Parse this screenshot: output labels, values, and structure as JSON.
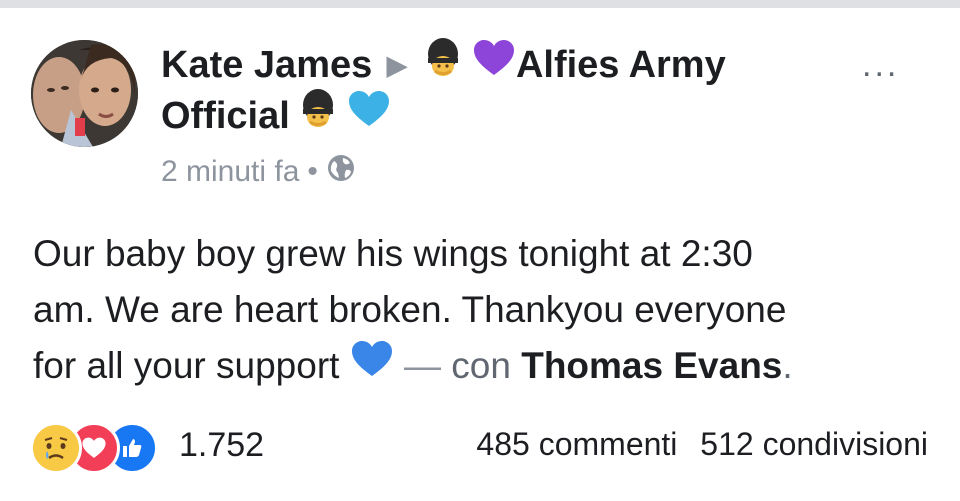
{
  "post": {
    "author": "Kate James",
    "group_name_line1": "Alfies Army",
    "group_name_line2": "Official",
    "time": "2 minuti fa",
    "separator_dot": "•",
    "body_line1": "Our baby boy grew his wings tonight at 2:30",
    "body_line2": "am. We are heart broken. Thankyou everyone",
    "body_line3": "for all your support",
    "dash": "—",
    "with_label": "con",
    "tagged": "Thomas Evans",
    "period": ".",
    "more_label": "..."
  },
  "footer": {
    "reaction_count": "1.752",
    "comments": "485 commenti",
    "shares": "512 condivisioni"
  },
  "icons": {
    "privacy": "globe-icon",
    "guard_emoji": "guardsman-emoji",
    "purple_heart": "purple-heart-emoji",
    "blue_heart": "blue-heart-emoji",
    "reactions": [
      "sad-reaction-icon",
      "love-reaction-icon",
      "like-reaction-icon"
    ]
  },
  "colors": {
    "purple_heart": "#8c44d9",
    "light_blue_heart": "#3bb1e6",
    "blue_heart": "#3a86e8",
    "like": "#1877f2",
    "love": "#f33e58",
    "sad": "#f7c945",
    "muted": "#8d949e"
  }
}
